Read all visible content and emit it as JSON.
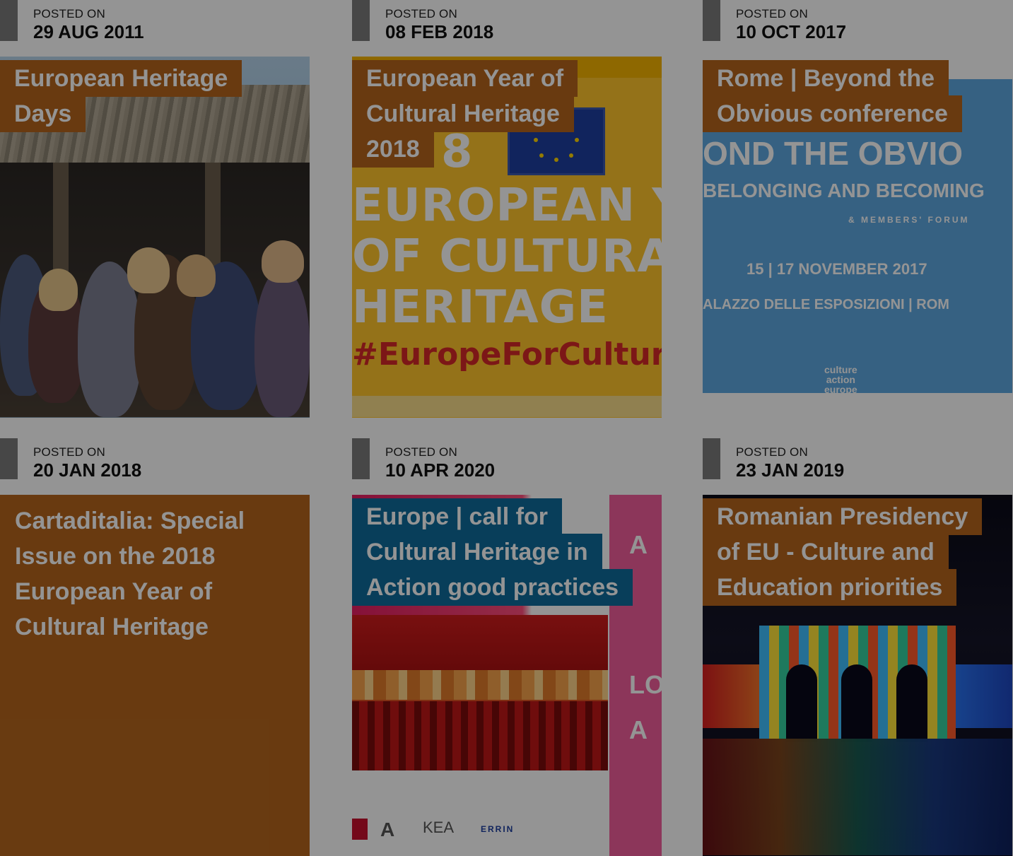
{
  "posts": [
    {
      "posted_label": "POSTED ON",
      "date": "29 AUG 2011",
      "title_lines": [
        "European Heritage",
        "Days"
      ],
      "title_style": "orange",
      "image": "children-under-thatched-hut"
    },
    {
      "posted_label": "POSTED ON",
      "date": "08 FEB 2018",
      "title_lines": [
        "European Year of",
        "Cultural Heritage",
        "2018"
      ],
      "title_style": "orange",
      "image": "european-year-of-cultural-heritage-poster",
      "poster": {
        "year_fragment": "8",
        "lines": [
          "EUROPEAN YEAR",
          "OF CULTURAL",
          "HERITAGE"
        ],
        "hashtag": "#EuropeForCulture"
      }
    },
    {
      "posted_label": "POSTED ON",
      "date": "10 OCT 2017",
      "title_lines": [
        "Rome | Beyond the",
        "Obvious conference"
      ],
      "title_style": "orange",
      "image": "beyond-the-obvious-banner",
      "banner": {
        "headline": "OND THE OBVIO",
        "subline": "BELONGING AND BECOMING",
        "forum": "& MEMBERS' FORUM",
        "dates": "15 | 17 NOVEMBER 2017",
        "venue": "ALAZZO DELLE ESPOSIZIONI | ROM",
        "logo_lines": [
          "culture",
          "action",
          "europe"
        ]
      }
    },
    {
      "posted_label": "POSTED ON",
      "date": "20 JAN 2018",
      "title_lines": [
        "Cartaditalia: Special Issue on the 2018 European Year of Cultural Heritage"
      ],
      "title_style": "plain",
      "image": "none"
    },
    {
      "posted_label": "POSTED ON",
      "date": "10 APR 2020",
      "title_lines": [
        "Europe | call for",
        "Cultural Heritage in",
        "Action good practices"
      ],
      "title_style": "blue",
      "image": "theatre-interior-brochure",
      "side_letters": [
        "A",
        "LO",
        "A"
      ],
      "logos": [
        "KEA",
        "ERRIN"
      ]
    },
    {
      "posted_label": "POSTED ON",
      "date": "23 JAN 2019",
      "title_lines": [
        "Romanian Presidency",
        "of EU - Culture and",
        "Education priorities"
      ],
      "title_style": "orange",
      "image": "illuminated-triumphal-arch-at-night"
    }
  ],
  "colors": {
    "accent_orange": "#b5651d",
    "accent_blue": "#0f6c9b",
    "overlay": "rgba(0,0,0,0.42)"
  }
}
